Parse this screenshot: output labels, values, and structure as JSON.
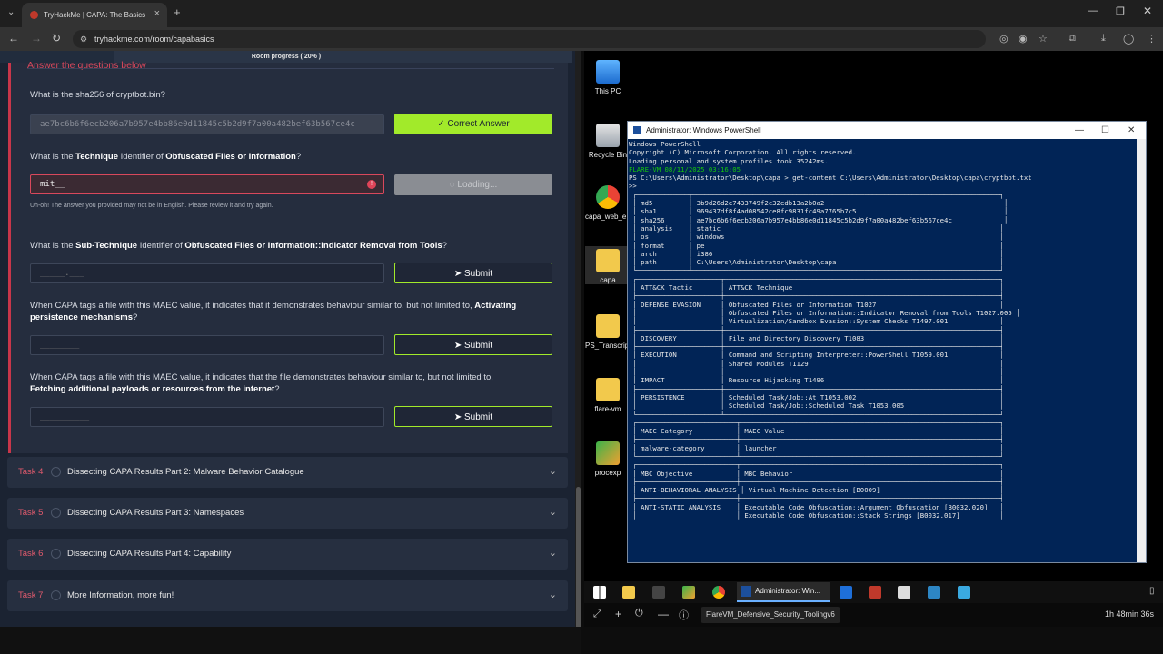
{
  "browser": {
    "tab_title": "TryHackMe | CAPA: The Basics",
    "url": "tryhackme.com/room/capabasics"
  },
  "room": {
    "progress_label": "Room progress ( 20% )",
    "progress": 0.2,
    "section_header": "Answer the questions below"
  },
  "questions": [
    {
      "text_pre": "What is the sha256 of cryptbot.bin?",
      "answer": "ae7bc6b6f6ecb206a7b957e4bb86e0d11845c5b2d9f7a00a482bef63b567ce4c",
      "button": "✓ Correct Answer"
    },
    {
      "text_pre": "What is the ",
      "b1": "Technique",
      "mid": " Identifier of ",
      "b2": "Obfuscated Files or Information",
      "post": "?",
      "answer": "mit__",
      "button": "Loading...",
      "error": "Uh-oh! The answer you provided may not be in English. Please review it and try again."
    },
    {
      "text_pre": "What is the ",
      "b1": "Sub-Technique",
      "mid": " Identifier of ",
      "b2": "Obfuscated Files or Information::Indicator Removal from Tools",
      "post": "?",
      "placeholder": "_____.___",
      "button": "Submit"
    },
    {
      "text_pre": "When CAPA tags a file with this MAEC value, it indicates that it demonstrates behaviour similar to, but not limited to, ",
      "b1": "Activating persistence mechanisms",
      "post": "?",
      "placeholder": "________",
      "button": "Submit"
    },
    {
      "text_pre": "When CAPA tags a file with this MAEC value, it indicates that the file demonstrates behaviour similar to, but not limited to, ",
      "b1": "Fetching additional payloads or resources from the internet",
      "post": "?",
      "placeholder": "__________",
      "button": "Submit"
    }
  ],
  "tasks": [
    {
      "num": "Task 4",
      "title": "Dissecting CAPA Results Part 2: Malware Behavior Catalogue"
    },
    {
      "num": "Task 5",
      "title": "Dissecting CAPA Results Part 3: Namespaces"
    },
    {
      "num": "Task 6",
      "title": "Dissecting CAPA Results Part 4: Capability"
    },
    {
      "num": "Task 7",
      "title": "More Information, more fun!"
    }
  ],
  "desktop_icons": [
    "This PC",
    "Recycle Bin",
    "capa_web_e...",
    "capa",
    "PS_Transcripts",
    "flare-vm",
    "procexp"
  ],
  "powershell": {
    "title": "Administrator: Windows PowerShell",
    "lines": [
      "Windows PowerShell",
      "Copyright (C) Microsoft Corporation. All rights reserved.",
      "",
      "Loading personal and system profiles took 35242ms.",
      "FLARE-VM 08/11/2025 03:16:05",
      "PS C:\\Users\\Administrator\\Desktop\\capa > get-content C:\\Users\\Administrator\\Desktop\\capa\\cryptbot.txt",
      ">>",
      " ┌─────────────┬─────────────────────────────────────────────────────────────────────────────┐",
      " │ md5         │ 3b9d26d2e7433749f2c32edb13a2b0a2                                             │",
      " │ sha1        │ 969437df8f4ad08542ce8fc9831fc49a7765b7c5                                     │",
      " │ sha256      │ ae7bc6b6f6ecb206a7b957e4bb86e0d11845c5b2d9f7a00a482bef63b567ce4c             │",
      " │ analysis    │ static                                                                      │",
      " │ os          │ windows                                                                     │",
      " │ format      │ pe                                                                          │",
      " │ arch        │ i386                                                                        │",
      " │ path        │ C:\\Users\\Administrator\\Desktop\\capa                                         │",
      " └─────────────┴─────────────────────────────────────────────────────────────────────────────┘",
      "",
      " ┌─────────────────────┬─────────────────────────────────────────────────────────────────────┐",
      " │ ATT&CK Tactic       │ ATT&CK Technique                                                    │",
      " ├─────────────────────┼─────────────────────────────────────────────────────────────────────┤",
      " │ DEFENSE EVASION     │ Obfuscated Files or Information T1027                               │",
      " │                     │ Obfuscated Files or Information::Indicator Removal from Tools T1027.005 │",
      " │                     │ Virtualization/Sandbox Evasion::System Checks T1497.001             │",
      " ├─────────────────────┼─────────────────────────────────────────────────────────────────────┤",
      " │ DISCOVERY           │ File and Directory Discovery T1083                                  │",
      " ├─────────────────────┼─────────────────────────────────────────────────────────────────────┤",
      " │ EXECUTION           │ Command and Scripting Interpreter::PowerShell T1059.001             │",
      " │                     │ Shared Modules T1129                                                │",
      " ├─────────────────────┼─────────────────────────────────────────────────────────────────────┤",
      " │ IMPACT              │ Resource Hijacking T1496                                            │",
      " ├─────────────────────┼─────────────────────────────────────────────────────────────────────┤",
      " │ PERSISTENCE         │ Scheduled Task/Job::At T1053.002                                    │",
      " │                     │ Scheduled Task/Job::Scheduled Task T1053.005                        │",
      " └─────────────────────┴─────────────────────────────────────────────────────────────────────┘",
      "",
      " ┌─────────────────────────┬─────────────────────────────────────────────────────────────────┐",
      " │ MAEC Category           │ MAEC Value                                                      │",
      " ├─────────────────────────┼─────────────────────────────────────────────────────────────────┤",
      " │ malware-category        │ launcher                                                        │",
      " └─────────────────────────┴─────────────────────────────────────────────────────────────────┘",
      "",
      " ┌─────────────────────────┬─────────────────────────────────────────────────────────────────┐",
      " │ MBC Objective           │ MBC Behavior                                                    │",
      " ├─────────────────────────┼─────────────────────────────────────────────────────────────────┤",
      " │ ANTI-BEHAVIORAL ANALYSIS │ Virtual Machine Detection [B0009]                              │",
      " ├─────────────────────────┼─────────────────────────────────────────────────────────────────┤",
      " │ ANTI-STATIC ANALYSIS    │ Executable Code Obfuscation::Argument Obfuscation [B0032.020]   │",
      " │                         │ Executable Code Obfuscation::Stack Strings [B0032.017]          │"
    ]
  },
  "vm_taskbar": {
    "active_window": "Administrator: Win..."
  },
  "vm_status": {
    "machine_name": "FlareVM_Defensive_Security_Toolingv6",
    "time_left": "1h 48min 36s"
  },
  "colors": {
    "accent_red": "#c8364a",
    "accent_green": "#a2ea2a",
    "page_bg": "#1b2332",
    "ps_bg": "#012456"
  }
}
